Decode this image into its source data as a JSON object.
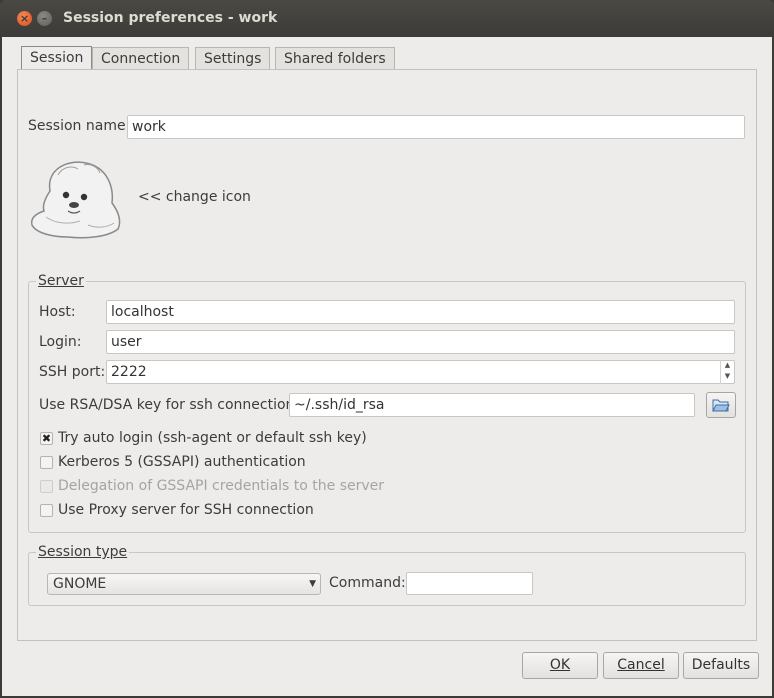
{
  "window": {
    "title": "Session preferences - work",
    "close_glyph": "×",
    "minimize_glyph": "–"
  },
  "tabs": [
    {
      "label": "Session",
      "active": true
    },
    {
      "label": "Connection",
      "active": false
    },
    {
      "label": "Settings",
      "active": false
    },
    {
      "label": "Shared folders",
      "active": false
    }
  ],
  "session": {
    "name_label": "Session name:",
    "name_value": "work",
    "change_icon_label": "<< change icon"
  },
  "server": {
    "group_title": "Server",
    "host_label": "Host:",
    "host_value": "localhost",
    "login_label": "Login:",
    "login_value": "user",
    "ssh_port_label": "SSH port:",
    "ssh_port_value": "2222",
    "key_label": "Use RSA/DSA key for ssh connection:",
    "key_value": "~/.ssh/id_rsa",
    "options": [
      {
        "label": "Try auto login (ssh-agent or default ssh key)",
        "checked": true,
        "enabled": true,
        "mark": "✖"
      },
      {
        "label": "Kerberos 5 (GSSAPI) authentication",
        "checked": false,
        "enabled": true,
        "mark": ""
      },
      {
        "label": "Delegation of GSSAPI credentials to the server",
        "checked": false,
        "enabled": false,
        "mark": ""
      },
      {
        "label": "Use Proxy server for SSH connection",
        "checked": false,
        "enabled": true,
        "mark": ""
      }
    ]
  },
  "session_type": {
    "group_title": "Session type",
    "selected": "GNOME",
    "command_label": "Command:",
    "command_value": ""
  },
  "buttons": {
    "ok": "OK",
    "cancel": "Cancel",
    "defaults": "Defaults"
  },
  "icons": {
    "session_icon": "seal-mascot-icon",
    "folder_icon": "folder-open-icon"
  },
  "colors": {
    "titlebar": "#3c3b37",
    "close_button": "#df4b16",
    "dialog_bg": "#edeceb"
  }
}
